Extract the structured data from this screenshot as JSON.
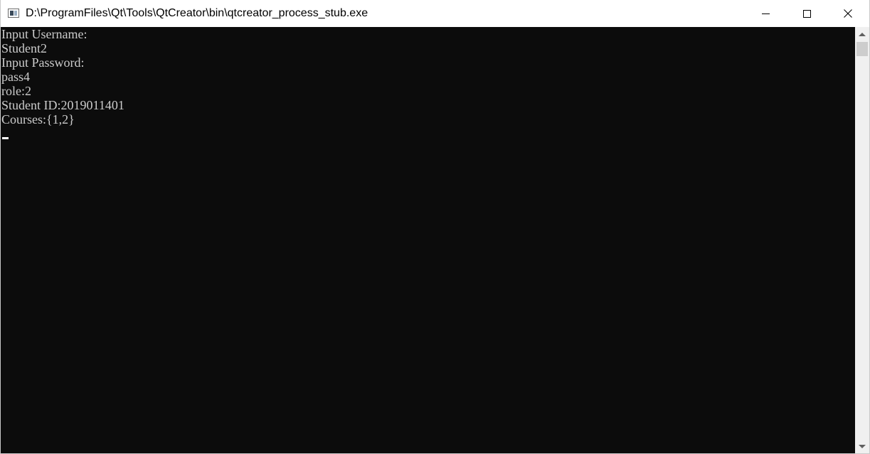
{
  "window": {
    "title": "D:\\ProgramFiles\\Qt\\Tools\\QtCreator\\bin\\qtcreator_process_stub.exe",
    "app_icon": "console-window-icon",
    "controls": {
      "minimize_icon": "minimize-icon",
      "maximize_icon": "maximize-icon",
      "close_icon": "close-icon",
      "close_glyph": "✕"
    }
  },
  "console": {
    "background": "#0c0c0c",
    "foreground": "#cccccc",
    "lines": [
      "Input Username:",
      "Student2",
      "Input Password:",
      "pass4",
      "role:2",
      "Student ID:2019011401",
      "Courses:{1,2}"
    ]
  },
  "scrollbar": {
    "up_icon": "scroll-up-arrow-icon",
    "down_icon": "scroll-down-arrow-icon"
  }
}
